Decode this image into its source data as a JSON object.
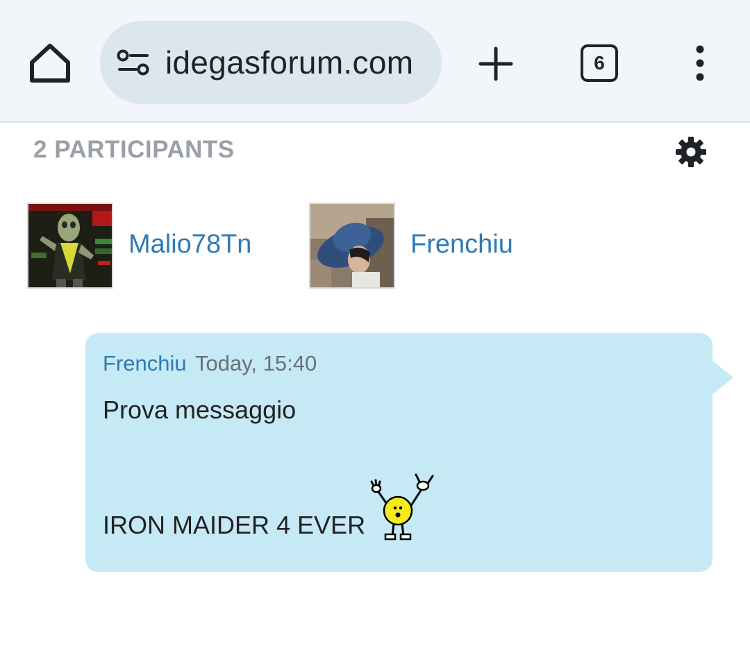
{
  "browser": {
    "url": "idegasforum.com",
    "tab_count": "6",
    "icons": {
      "home": "home-icon",
      "site_settings": "tune-icon",
      "new_tab": "plus-icon",
      "tabs": "tab-switcher-icon",
      "menu": "more-vertical-icon"
    }
  },
  "conversation": {
    "participants_heading": "2 PARTICIPANTS",
    "settings_icon": "gear-icon",
    "participants": [
      {
        "name": "Malio78Tn",
        "avatar": "avatar-figure-image"
      },
      {
        "name": "Frenchiu",
        "avatar": "avatar-hat-image"
      }
    ]
  },
  "message": {
    "author": "Frenchiu",
    "time": "Today, 15:40",
    "line1": "Prova messaggio",
    "line2": "IRON MAIDER 4 EVER",
    "emoji": "rock-on-smiley"
  },
  "colors": {
    "link": "#2f7ab5",
    "bubble": "#c6e9f6",
    "heading_gray": "#9aa0a6",
    "browser_bar": "#f2f6fb",
    "url_pill": "#dbe6ef"
  }
}
